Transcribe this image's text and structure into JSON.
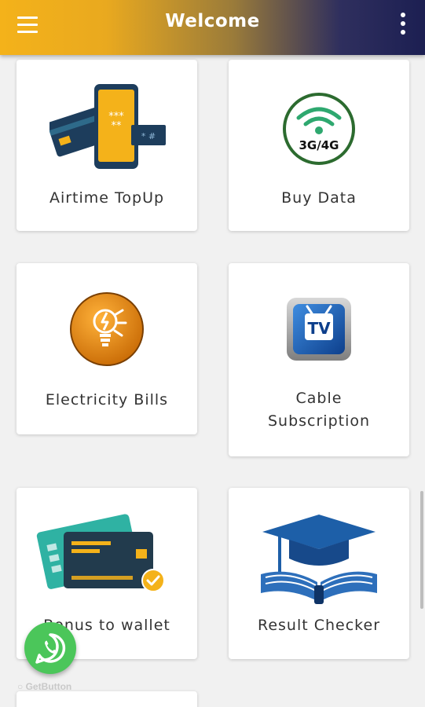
{
  "header": {
    "title": "Welcome",
    "menu_icon": "hamburger-menu-icon",
    "more_icon": "more-vertical-icon",
    "gradient": [
      "#f4b21a",
      "#1c1f52"
    ]
  },
  "services": [
    {
      "label": "Airtime TopUp",
      "icon": "phone-card-icon"
    },
    {
      "label": "Buy Data",
      "icon": "3g-4g-wifi-icon",
      "icon_text": "3G/4G"
    },
    {
      "label": "Electricity Bills",
      "icon": "bulb-icon"
    },
    {
      "label_lines": [
        "Cable",
        "Subscription"
      ],
      "icon": "tv-icon",
      "icon_text": "TV"
    },
    {
      "label": "Bonus to wallet",
      "icon": "wallet-cards-icon"
    },
    {
      "label": "Result Checker",
      "icon": "graduation-book-icon"
    }
  ],
  "floating": {
    "whatsapp_icon": "whatsapp-icon",
    "credit": "GetButton",
    "whatsapp_color": "#4bc65a"
  }
}
